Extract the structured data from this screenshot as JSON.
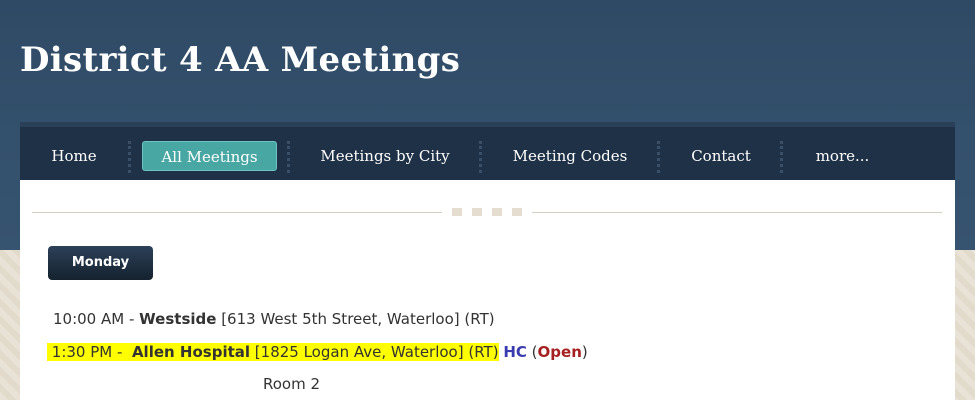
{
  "site": {
    "title": "District 4 AA Meetings"
  },
  "nav": {
    "items": [
      {
        "label": "Home"
      },
      {
        "label": "All Meetings"
      },
      {
        "label": "Meetings by City"
      },
      {
        "label": "Meeting Codes"
      },
      {
        "label": "Contact"
      },
      {
        "label": "more..."
      }
    ],
    "active": "All Meetings",
    "active_color": "#48a7a3"
  },
  "content": {
    "day_button": "Monday",
    "meetings": [
      {
        "time": "10:00 AM - ",
        "name": "Westside",
        "address": " [613 West 5th Street, Waterloo] (RT)"
      },
      {
        "time": "1:30 PM -  ",
        "name": "Allen Hospital",
        "address": "  [1825 Logan Ave, Waterloo] (RT)",
        "code": "HC",
        "paren_open": " (",
        "status": "Open",
        "paren_close": ")",
        "note": "Room 2",
        "highlight_color": "#ffff00"
      }
    ]
  }
}
